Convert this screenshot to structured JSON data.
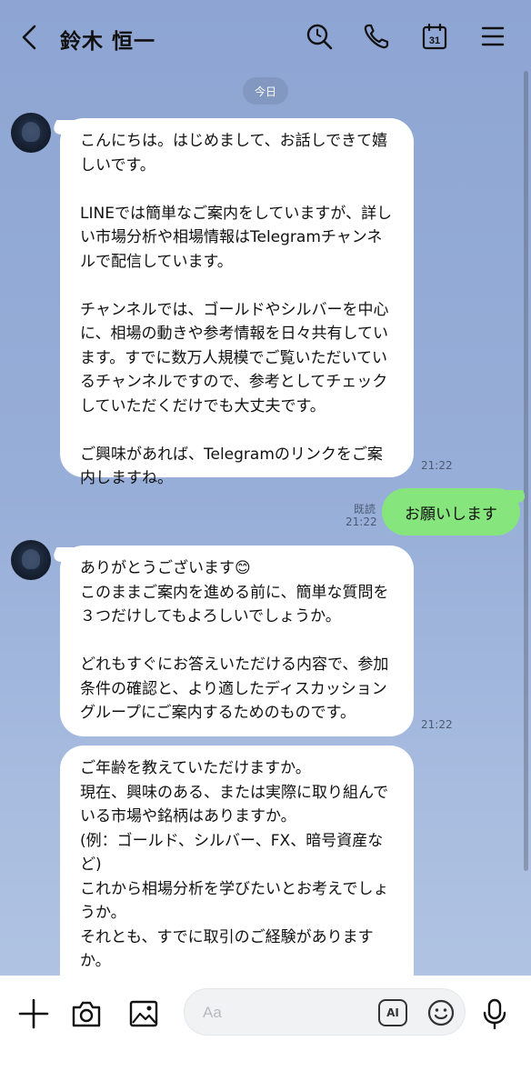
{
  "header": {
    "contact_name": "鈴木 恒一",
    "calendar_day": "31"
  },
  "date_label": "今日",
  "messages": [
    {
      "from": "contact",
      "text": "こんにちは。はじめまして、お話しできて嬉しいです。\n\nLINEでは簡単なご案内をしていますが、詳しい市場分析や相場情報はTelegramチャンネルで配信しています。\n\nチャンネルでは、ゴールドやシルバーを中心に、相場の動きや参考情報を日々共有しています。すでに数万人規模でご覧いただいているチャンネルですので、参考としてチェックしていただくだけでも大丈夫です。\n\nご興味があれば、Telegramのリンクをご案内しますね。",
      "time": "21:22"
    },
    {
      "from": "me",
      "text": "お願いします",
      "read_label": "既読",
      "time": "21:22"
    },
    {
      "from": "contact",
      "text": "ありがとうございます😊\nこのままご案内を進める前に、簡単な質問を３つだけしてもよろしいでしょうか。\n\nどれもすぐにお答えいただける内容で、参加条件の確認と、より適したディスカッショングループにご案内するためのものです。",
      "time": "21:22"
    },
    {
      "from": "contact",
      "text": "ご年齢を教えていただけますか。\n現在、興味のある、または実際に取り組んでいる市場や銘柄はありますか。\n(例：ゴールド、シルバー、FX、暗号資産など)\nこれから相場分析を学びたいとお考えでしょうか。\nそれとも、すでに取引のご経験がありますか。\n\nご回答ありがとうございます。"
    }
  ],
  "input": {
    "placeholder": "Aa",
    "ai_label": "AI"
  },
  "colors": {
    "background": "#93aad6",
    "sent_bubble": "#86e57c",
    "received_bubble": "#ffffff"
  },
  "icons": [
    "back-icon",
    "search-icon",
    "phone-icon",
    "calendar-icon",
    "menu-icon",
    "plus-icon",
    "camera-icon",
    "image-icon",
    "ai-icon",
    "emoji-icon",
    "mic-icon"
  ]
}
